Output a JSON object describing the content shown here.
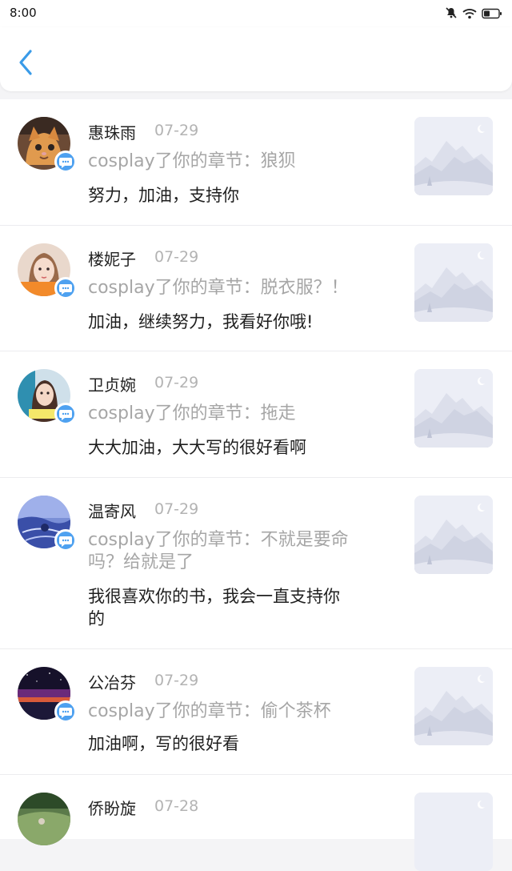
{
  "status_bar": {
    "time": "8:00",
    "icons": [
      "mute-icon",
      "wifi-icon",
      "battery-icon"
    ]
  },
  "header": {
    "back_icon": "back-arrow-icon"
  },
  "colors": {
    "accent": "#4ea1f0",
    "secondary_text": "#a6a6a6",
    "divider": "#ececef"
  },
  "comments": [
    {
      "name": "惠珠雨",
      "date": "07-29",
      "chapter_lines": [
        "cosplay了你的章节：狼狈"
      ],
      "comment_lines": [
        "努力，加油，支持你"
      ]
    },
    {
      "name": "楼妮子",
      "date": "07-29",
      "chapter_lines": [
        "cosplay了你的章节：脱衣服？！"
      ],
      "comment_lines": [
        "加油，继续努力，我看好你哦!"
      ]
    },
    {
      "name": "卫贞婉",
      "date": "07-29",
      "chapter_lines": [
        "cosplay了你的章节：拖走"
      ],
      "comment_lines": [
        "大大加油，大大写的很好看啊"
      ]
    },
    {
      "name": "温寄风",
      "date": "07-29",
      "chapter_lines": [
        "cosplay了你的章节：不就是要命",
        "吗？给就是了"
      ],
      "comment_lines": [
        "我很喜欢你的书，我会一直支持你",
        "的"
      ]
    },
    {
      "name": "公冶芬",
      "date": "07-29",
      "chapter_lines": [
        "cosplay了你的章节：偷个茶杯"
      ],
      "comment_lines": [
        "加油啊，写的很好看"
      ]
    },
    {
      "name": "侨盼旋",
      "date": "07-28",
      "chapter_lines": [],
      "comment_lines": []
    }
  ]
}
